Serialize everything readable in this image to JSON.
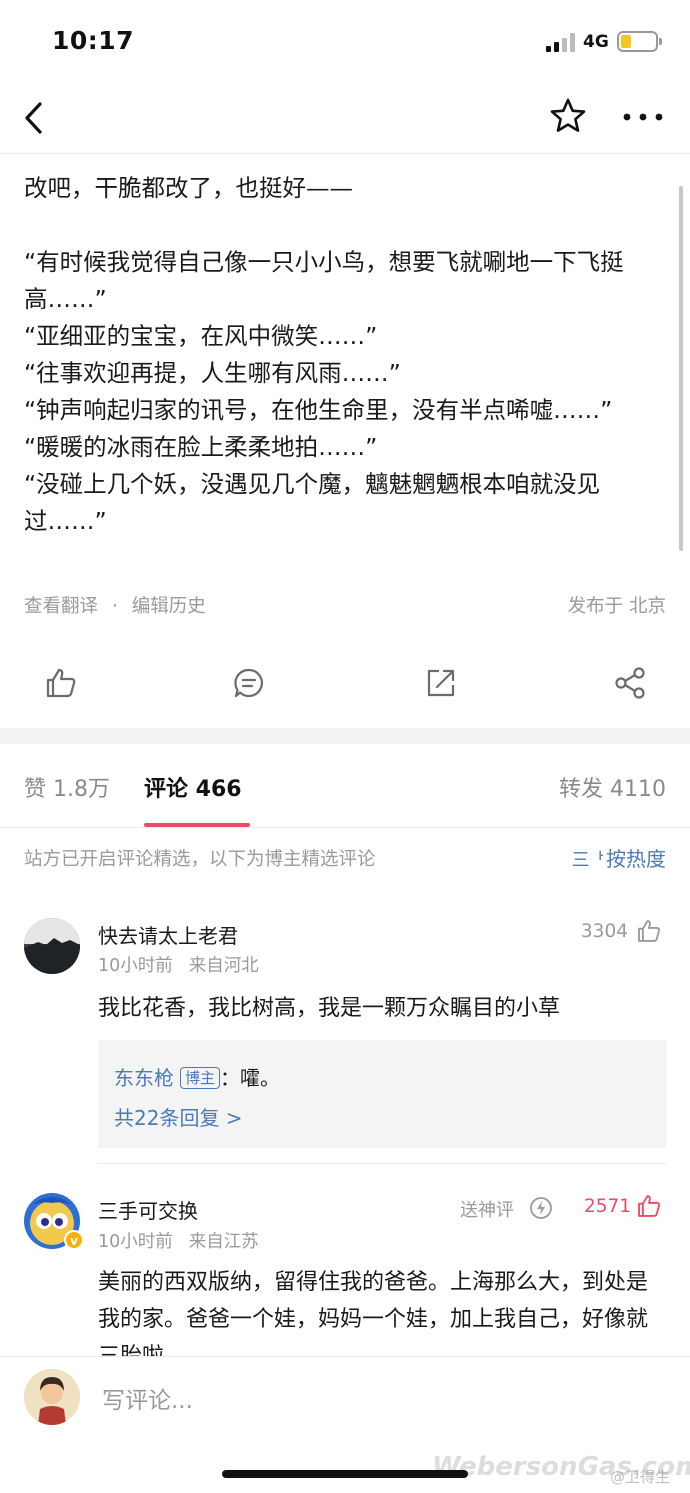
{
  "status_bar": {
    "time": "10:17",
    "network": "4G"
  },
  "article": {
    "text": "改吧，干脆都改了，也挺好——\n\n“有时候我觉得自己像一只小小鸟，想要飞就唰地一下飞挺高……”\n“亚细亚的宝宝，在风中微笑……”\n“往事欢迎再提，人生哪有风雨……”\n“钟声响起归家的讯号，在他生命里，没有半点唏嘘……”\n“暖暖的冰雨在脸上柔柔地拍……”\n“没碰上几个妖，没遇见几个魔，魑魅魍魉根本咱就没见过……”",
    "translate_link": "查看翻译",
    "meta_separator": "·",
    "edit_history_link": "编辑历史",
    "location": "发布于 北京"
  },
  "tabs": {
    "likes": "赞 1.8万",
    "comments": "评论 466",
    "reposts": "转发 4110"
  },
  "notice": "站方已开启评论精选，以下为博主精选评论",
  "sort": {
    "icon": "三ᅡ",
    "label": "按热度"
  },
  "comments": [
    {
      "user": "快去请太上老君",
      "time": "10小时前",
      "from": "来自河北",
      "text": "我比花香，我比树高，我是一颗万众瞩目的小草",
      "likes": "3304",
      "reply": {
        "author": "东东枪",
        "badge": "博主",
        "text": "：嚯。",
        "more": "共22条回复 >"
      }
    },
    {
      "user": "三手可交换",
      "time": "10小时前",
      "from": "来自江苏",
      "text": "美丽的西双版纳，留得住我的爸爸。上海那么大，到处是我的家。爸爸一个娃，妈妈一个娃，加上我自己，好像就三胎啦",
      "god_label": "送神评",
      "likes": "2571",
      "like_color": "#f44866"
    }
  ],
  "input": {
    "placeholder": "写评论..."
  },
  "watermark": {
    "main": "WebersonGas.com",
    "small": "@卫得生"
  },
  "colors": {
    "accent": "#f44866",
    "link": "#4a7ab8"
  }
}
